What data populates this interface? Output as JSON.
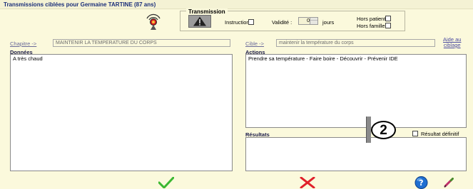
{
  "window": {
    "title": "Transmissions ciblées pour  Germaine TARTINE (87 ans)"
  },
  "transmission": {
    "group_title": "Transmission",
    "instruction_label": "Instruction",
    "validite_label": "Validité :",
    "validite_value": "0",
    "jours_label": "jours",
    "hors_patient_label": "Hors patient",
    "hors_famille_label": "Hors famille"
  },
  "chapitre": {
    "link": "Chapitre ->",
    "value": "MAINTENIR LA TEMPERATURE DU CORPS"
  },
  "cible": {
    "link": "Cible ->",
    "value": "maintenir la température du corps"
  },
  "aide": {
    "line1": "Aide au",
    "line2": "ciblage"
  },
  "donnees": {
    "header": "Données",
    "content": "A très chaud"
  },
  "actions": {
    "header": "Actions",
    "content": "Prendre sa température - Faire boire - Découvrir - Prévenir IDE"
  },
  "resultats": {
    "header": "Résultats",
    "definitif_label": "Résultat définitif"
  },
  "callout": {
    "label": "2"
  },
  "icons": {
    "transmission_icon": "broadcast-icon",
    "warning_icon": "warning-icon",
    "validate": "checkmark-icon",
    "cancel": "cross-icon",
    "help": "help-icon",
    "edit": "pen-icon"
  },
  "colors": {
    "background": "#fbf9dc",
    "title": "#1b2f7a",
    "ok": "#3cb832",
    "cancel": "#e0202a",
    "help": "#1f6fd1"
  }
}
